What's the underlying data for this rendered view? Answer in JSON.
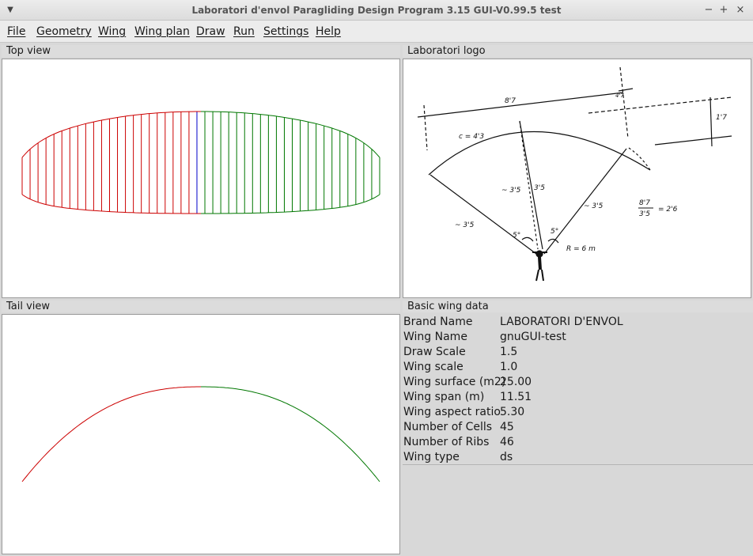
{
  "window": {
    "title": "Laboratori d'envol Paragliding Design Program 3.15 GUI-V0.99.5 test",
    "controls": [
      "−",
      "+",
      "×"
    ]
  },
  "menu": [
    "File",
    "Geometry",
    "Wing",
    "Wing plan",
    "Draw",
    "Run",
    "Settings",
    "Help"
  ],
  "panels": {
    "top_view": "Top view",
    "logo": "Laboratori logo",
    "tail_view": "Tail view",
    "wing_data": "Basic wing data"
  },
  "wing_data": [
    {
      "label": "Brand Name",
      "value": "LABORATORI D'ENVOL"
    },
    {
      "label": "Wing Name",
      "value": "gnuGUI-test"
    },
    {
      "label": "Draw Scale",
      "value": "1.5"
    },
    {
      "label": "Wing scale",
      "value": "1.0"
    },
    {
      "label": "Wing surface (m2)",
      "value": "25.00"
    },
    {
      "label": "Wing span (m)",
      "value": "11.51"
    },
    {
      "label": "Wing aspect ratio",
      "value": "5.30"
    },
    {
      "label": "Number of Cells",
      "value": "45"
    },
    {
      "label": "Number of Ribs",
      "value": "46"
    },
    {
      "label": "Wing type",
      "value": "ds"
    }
  ],
  "wing_geometry": {
    "ribs": 46,
    "left_color": "#cc0000",
    "right_color": "#007700",
    "center_color": "#0000cc"
  },
  "logo_sketch": {
    "dims": [
      "8'7",
      "4'7",
      "1'7"
    ],
    "notes": [
      "c = 4'3",
      "~ 3'5",
      "~ 3'5",
      "3'5",
      "~ 3'5",
      "5°",
      "5°",
      "R = 6 m",
      "8'7",
      "3'5",
      "= 2'6"
    ]
  },
  "colors": {
    "background": "#d8d8d8",
    "canvas": "#ffffff"
  }
}
